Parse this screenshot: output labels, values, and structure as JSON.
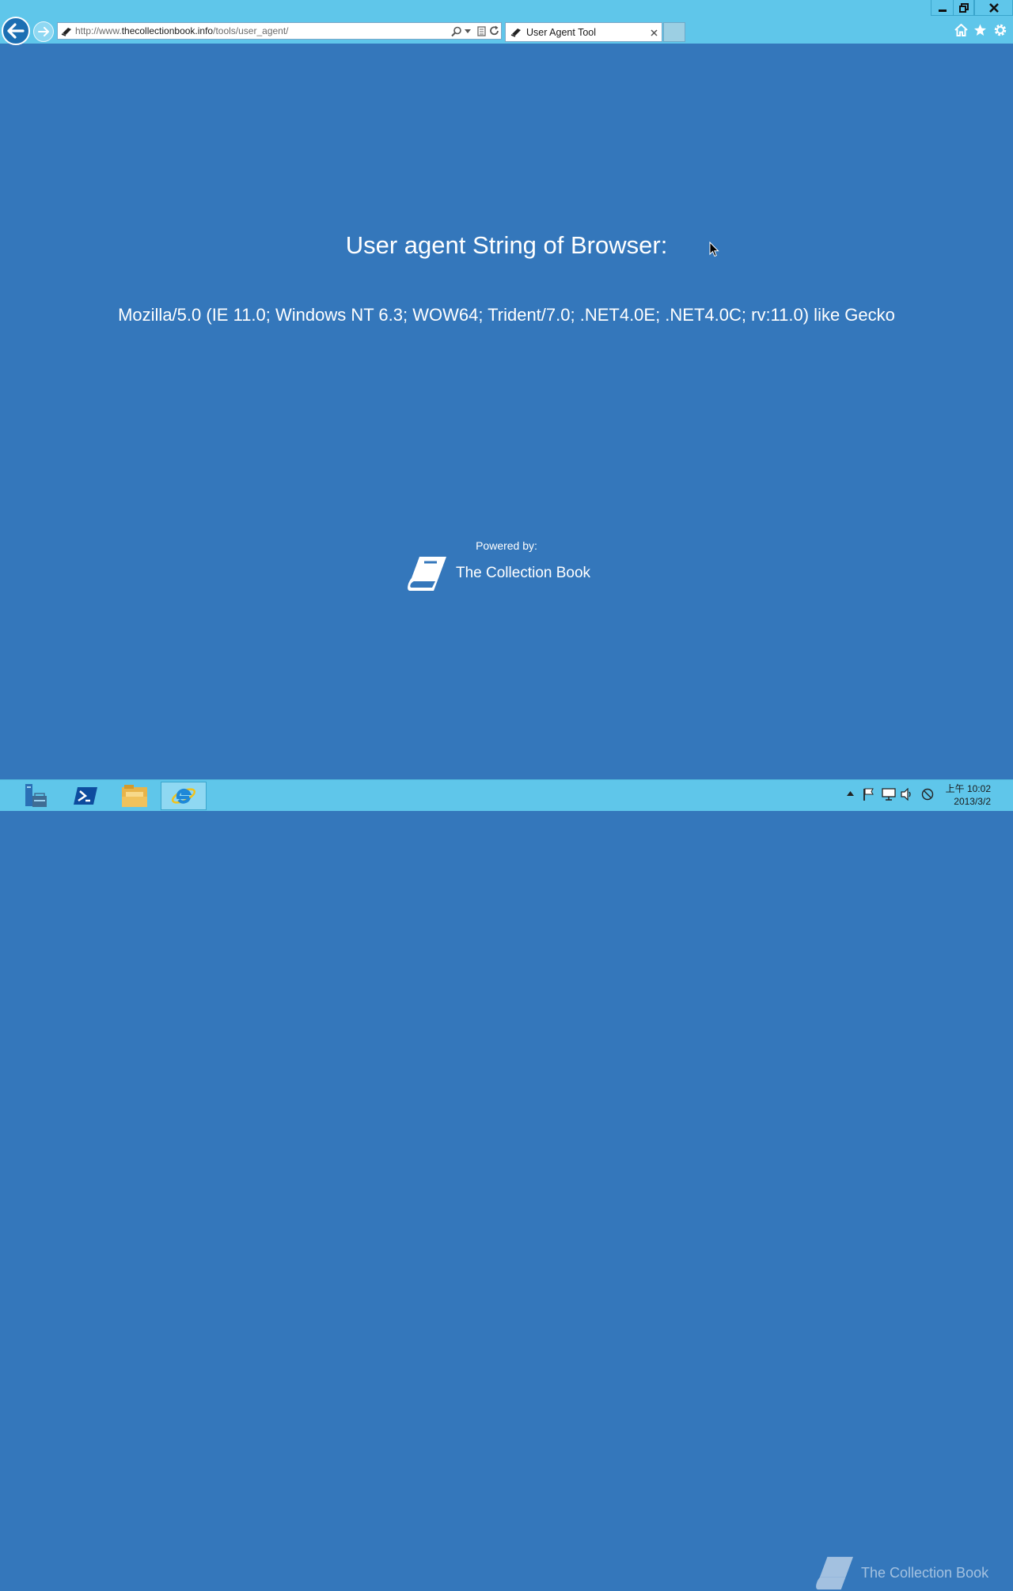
{
  "window": {
    "controls": [
      "minimize",
      "restore",
      "close"
    ]
  },
  "browser": {
    "address_prefix": "http://www.",
    "address_domain": "thecollectionbook.info",
    "address_path": "/tools/user_agent/",
    "tab_title": "User Agent Tool"
  },
  "page": {
    "heading": "User agent String of Browser:",
    "user_agent": "Mozilla/5.0 (IE 11.0; Windows NT 6.3; WOW64; Trident/7.0; .NET4.0E; .NET4.0C; rv:11.0) like Gecko",
    "powered_by_label": "Powered by:",
    "brand_name": "The Collection Book"
  },
  "taskbar": {
    "apps": [
      "server-manager",
      "powershell",
      "file-explorer",
      "internet-explorer"
    ],
    "active_app": "internet-explorer",
    "watermark": "The Collection Book",
    "clock_time": "上午 10:02",
    "clock_date": "2013/3/2"
  },
  "colors": {
    "page_background": "#3477bb",
    "chrome_background": "#5fc6ea",
    "text": "#ffffff"
  }
}
